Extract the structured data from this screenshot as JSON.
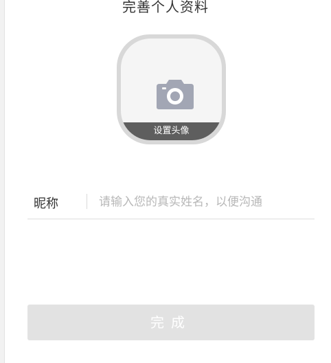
{
  "page": {
    "title": "完善个人资料"
  },
  "avatar": {
    "icon": "camera-icon",
    "label": "设置头像"
  },
  "nickname_field": {
    "label": "昵称",
    "value": "",
    "placeholder": "请输入您的真实姓名，以便沟通"
  },
  "actions": {
    "done_label": "完成"
  },
  "colors": {
    "avatar_border": "#d8d8d8",
    "avatar_fill": "#f5f5f5",
    "avatar_label_bar": "#5e5e5e",
    "camera_icon": "#a2a6b4",
    "button_disabled": "#e2e2e2",
    "divider": "#dedede"
  }
}
